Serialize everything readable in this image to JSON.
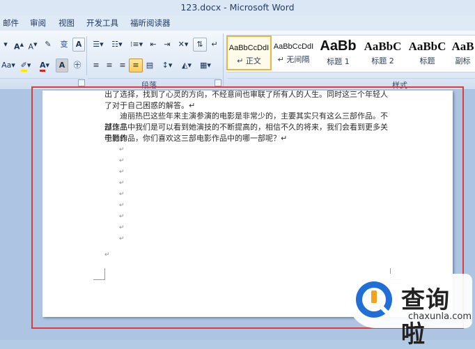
{
  "window": {
    "title": "123.docx - Microsoft Word"
  },
  "menu": {
    "tabs": [
      "邮件",
      "审阅",
      "视图",
      "开发工具",
      "福昕阅读器"
    ]
  },
  "ribbon": {
    "font_buttons": [
      "A",
      "A",
      "Aa",
      "A",
      "A"
    ],
    "groups": {
      "paragraph": "段落",
      "styles": "样式"
    },
    "styles": [
      {
        "sample": "AaBbCcDdI",
        "name": "↵ 正文"
      },
      {
        "sample": "AaBbCcDdI",
        "name": "↵ 无间隔"
      },
      {
        "sample": "AaBb",
        "name": "标题 1"
      },
      {
        "sample": "AaBbC",
        "name": "标题 2"
      },
      {
        "sample": "AaBbC",
        "name": "标题"
      },
      {
        "sample": "AaB",
        "name": "副标"
      }
    ]
  },
  "document": {
    "paragraphs": [
      "出了选择，找到了心灵的方向，不经意间也审联了所有人的人生。同时这三个年轻人也联到",
      "了对于自己困惑的解答。↵",
      "迪丽热巴这些年来主演参演的电影是非常少的，主要其实只有这么三部作品。不过这三",
      "部作品中我们是可以看到她演技的不断提高的，相信不久的将来，我们会看到更多关于她的",
      "电影作品，你们喜欢这三部电影作品中的哪一部呢？↵"
    ],
    "empty_mark": "↵"
  },
  "watermark": {
    "cn": "查询啦",
    "en": "chaxunla.com"
  },
  "colors": {
    "highlight_border": "#e03a3a",
    "style_selected": "#f1b33f",
    "ribbon_bg": "#dce7f5"
  }
}
